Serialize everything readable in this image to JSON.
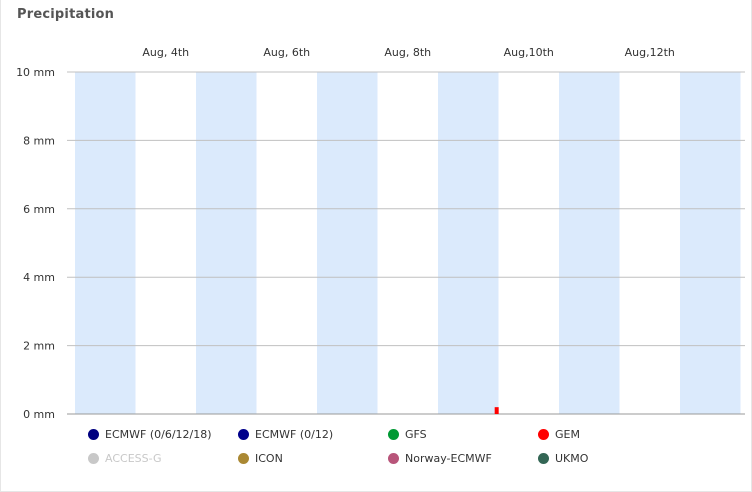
{
  "title": "Precipitation",
  "chart_data": {
    "type": "bar",
    "title": "Precipitation",
    "x_ticks": [
      "Aug, 4th",
      "Aug, 6th",
      "Aug, 8th",
      "Aug,10th",
      "Aug,12th"
    ],
    "y_ticks": [
      "0 mm",
      "2 mm",
      "4 mm",
      "6 mm",
      "8 mm",
      "10 mm"
    ],
    "ylim": [
      0,
      10
    ],
    "y_unit": "mm",
    "grid": true,
    "day_bands": 6,
    "series": [
      {
        "name": "ECMWF (0/6/12/18)",
        "color": "#000080",
        "values": []
      },
      {
        "name": "ECMWF (0/12)",
        "color": "#00008b",
        "values": []
      },
      {
        "name": "GFS",
        "color": "#009933",
        "values": []
      },
      {
        "name": "GEM",
        "color": "#ff0000",
        "values": [
          {
            "x": "Aug, 8th",
            "offset_days": 1.47,
            "y": 0.2
          }
        ]
      },
      {
        "name": "ACCESS-G",
        "color": "#c8c8c8",
        "values": [],
        "hidden": true
      },
      {
        "name": "ICON",
        "color": "#aa8833",
        "values": []
      },
      {
        "name": "Norway-ECMWF",
        "color": "#b8557a",
        "values": []
      },
      {
        "name": "UKMO",
        "color": "#336655",
        "values": []
      }
    ]
  }
}
